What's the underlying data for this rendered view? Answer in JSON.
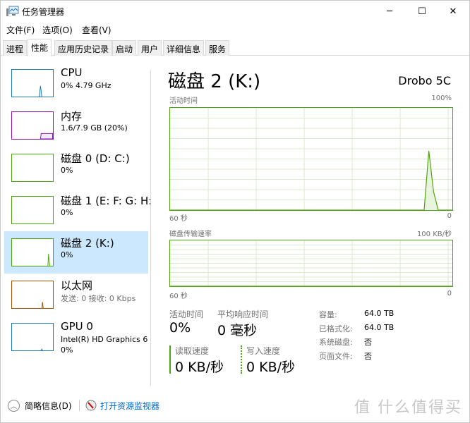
{
  "window": {
    "title": "任务管理器",
    "controls": {
      "minimize": "─",
      "maximize": "☐",
      "close": "✕"
    }
  },
  "menubar": {
    "items": [
      {
        "label": "文件(F)"
      },
      {
        "label": "选项(O)"
      },
      {
        "label": "查看(V)"
      }
    ]
  },
  "tabs": [
    {
      "label": "进程"
    },
    {
      "label": "性能",
      "active": true
    },
    {
      "label": "应用历史记录"
    },
    {
      "label": "启动"
    },
    {
      "label": "用户"
    },
    {
      "label": "详细信息"
    },
    {
      "label": "服务"
    }
  ],
  "sidebar": {
    "items": [
      {
        "name": "CPU",
        "sub": "0% 4.79 GHz",
        "color": "#1f7ab8"
      },
      {
        "name": "内存",
        "sub": "1.6/7.9 GB (20%)",
        "color": "#8b12ae"
      },
      {
        "name": "磁盘 0 (D: C:)",
        "sub": "0%",
        "color": "#4da60c"
      },
      {
        "name": "磁盘 1 (E: F: G: H:",
        "sub": "0%",
        "color": "#4da60c"
      },
      {
        "name": "磁盘 2 (K:)",
        "sub": "0%",
        "color": "#4da60c",
        "selected": true
      },
      {
        "name": "以太网",
        "sub": "发送: 0 接收: 0 Kbps",
        "color": "#a74f01"
      },
      {
        "name": "GPU 0",
        "sub": "Intel(R) HD Graphics 6",
        "sub2": "0%",
        "color": "#1f7ab8"
      }
    ]
  },
  "main": {
    "title": "磁盘 2 (K:)",
    "model": "Drobo 5C",
    "activity": {
      "label": "活动时间",
      "max_label": "100%",
      "left_label": "60 秒",
      "right_label": "0"
    },
    "transfer": {
      "label": "磁盘传输速率",
      "max_label": "100 KB/秒",
      "left_label": "60 秒",
      "right_label": "0"
    },
    "stats": {
      "active_time": {
        "label": "活动时间",
        "value": "0%"
      },
      "avg_response": {
        "label": "平均响应时间",
        "value": "0 毫秒"
      },
      "read_speed": {
        "label": "读取速度",
        "value": "0 KB/秒"
      },
      "write_speed": {
        "label": "写入速度",
        "value": "0 KB/秒"
      }
    },
    "properties": [
      {
        "key": "容量:",
        "value": "64.0 TB"
      },
      {
        "key": "已格式化:",
        "value": "64.0 TB"
      },
      {
        "key": "系统磁盘:",
        "value": "否"
      },
      {
        "key": "页面文件:",
        "value": "否"
      }
    ]
  },
  "footer": {
    "fewer_details": "简略信息(D)",
    "open_monitor": "打开资源监视器"
  },
  "watermark": "值 什么值得买",
  "chart_data": [
    {
      "type": "area",
      "title": "活动时间",
      "xlabel": "",
      "ylabel": "",
      "x_range_label": [
        "60 秒",
        "0"
      ],
      "ylim": [
        0,
        100
      ],
      "x_seconds_ago": [
        60,
        6,
        5,
        4,
        3,
        0
      ],
      "values": [
        0,
        0,
        58,
        18,
        0,
        0
      ],
      "grid": true
    },
    {
      "type": "area",
      "title": "磁盘传输速率",
      "x_range_label": [
        "60 秒",
        "0"
      ],
      "ylim": [
        0,
        100
      ],
      "yunit": "KB/秒",
      "x_seconds_ago": [
        60,
        0
      ],
      "values": [
        0,
        0
      ],
      "grid": true
    }
  ],
  "colors": {
    "disk": "#4da60c",
    "disk_fill": "#e8f4dd",
    "grid": "#dcebd0",
    "selected": "#cce8ff",
    "link": "#0066cc"
  }
}
